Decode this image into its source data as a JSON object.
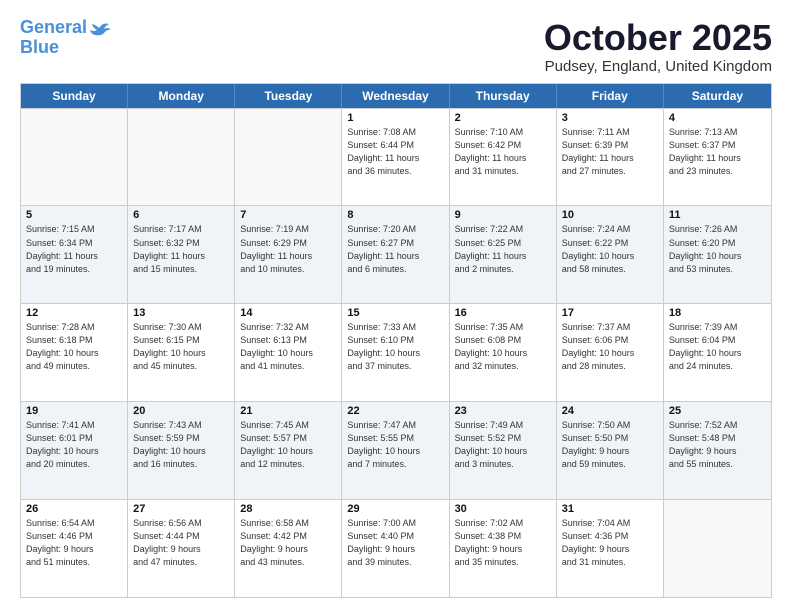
{
  "header": {
    "logo_line1": "General",
    "logo_line2": "Blue",
    "month": "October 2025",
    "location": "Pudsey, England, United Kingdom"
  },
  "weekdays": [
    "Sunday",
    "Monday",
    "Tuesday",
    "Wednesday",
    "Thursday",
    "Friday",
    "Saturday"
  ],
  "weeks": [
    [
      {
        "day": "",
        "info": "",
        "empty": true
      },
      {
        "day": "",
        "info": "",
        "empty": true
      },
      {
        "day": "",
        "info": "",
        "empty": true
      },
      {
        "day": "1",
        "info": "Sunrise: 7:08 AM\nSunset: 6:44 PM\nDaylight: 11 hours\nand 36 minutes.",
        "empty": false
      },
      {
        "day": "2",
        "info": "Sunrise: 7:10 AM\nSunset: 6:42 PM\nDaylight: 11 hours\nand 31 minutes.",
        "empty": false
      },
      {
        "day": "3",
        "info": "Sunrise: 7:11 AM\nSunset: 6:39 PM\nDaylight: 11 hours\nand 27 minutes.",
        "empty": false
      },
      {
        "day": "4",
        "info": "Sunrise: 7:13 AM\nSunset: 6:37 PM\nDaylight: 11 hours\nand 23 minutes.",
        "empty": false
      }
    ],
    [
      {
        "day": "5",
        "info": "Sunrise: 7:15 AM\nSunset: 6:34 PM\nDaylight: 11 hours\nand 19 minutes.",
        "empty": false
      },
      {
        "day": "6",
        "info": "Sunrise: 7:17 AM\nSunset: 6:32 PM\nDaylight: 11 hours\nand 15 minutes.",
        "empty": false
      },
      {
        "day": "7",
        "info": "Sunrise: 7:19 AM\nSunset: 6:29 PM\nDaylight: 11 hours\nand 10 minutes.",
        "empty": false
      },
      {
        "day": "8",
        "info": "Sunrise: 7:20 AM\nSunset: 6:27 PM\nDaylight: 11 hours\nand 6 minutes.",
        "empty": false
      },
      {
        "day": "9",
        "info": "Sunrise: 7:22 AM\nSunset: 6:25 PM\nDaylight: 11 hours\nand 2 minutes.",
        "empty": false
      },
      {
        "day": "10",
        "info": "Sunrise: 7:24 AM\nSunset: 6:22 PM\nDaylight: 10 hours\nand 58 minutes.",
        "empty": false
      },
      {
        "day": "11",
        "info": "Sunrise: 7:26 AM\nSunset: 6:20 PM\nDaylight: 10 hours\nand 53 minutes.",
        "empty": false
      }
    ],
    [
      {
        "day": "12",
        "info": "Sunrise: 7:28 AM\nSunset: 6:18 PM\nDaylight: 10 hours\nand 49 minutes.",
        "empty": false
      },
      {
        "day": "13",
        "info": "Sunrise: 7:30 AM\nSunset: 6:15 PM\nDaylight: 10 hours\nand 45 minutes.",
        "empty": false
      },
      {
        "day": "14",
        "info": "Sunrise: 7:32 AM\nSunset: 6:13 PM\nDaylight: 10 hours\nand 41 minutes.",
        "empty": false
      },
      {
        "day": "15",
        "info": "Sunrise: 7:33 AM\nSunset: 6:10 PM\nDaylight: 10 hours\nand 37 minutes.",
        "empty": false
      },
      {
        "day": "16",
        "info": "Sunrise: 7:35 AM\nSunset: 6:08 PM\nDaylight: 10 hours\nand 32 minutes.",
        "empty": false
      },
      {
        "day": "17",
        "info": "Sunrise: 7:37 AM\nSunset: 6:06 PM\nDaylight: 10 hours\nand 28 minutes.",
        "empty": false
      },
      {
        "day": "18",
        "info": "Sunrise: 7:39 AM\nSunset: 6:04 PM\nDaylight: 10 hours\nand 24 minutes.",
        "empty": false
      }
    ],
    [
      {
        "day": "19",
        "info": "Sunrise: 7:41 AM\nSunset: 6:01 PM\nDaylight: 10 hours\nand 20 minutes.",
        "empty": false
      },
      {
        "day": "20",
        "info": "Sunrise: 7:43 AM\nSunset: 5:59 PM\nDaylight: 10 hours\nand 16 minutes.",
        "empty": false
      },
      {
        "day": "21",
        "info": "Sunrise: 7:45 AM\nSunset: 5:57 PM\nDaylight: 10 hours\nand 12 minutes.",
        "empty": false
      },
      {
        "day": "22",
        "info": "Sunrise: 7:47 AM\nSunset: 5:55 PM\nDaylight: 10 hours\nand 7 minutes.",
        "empty": false
      },
      {
        "day": "23",
        "info": "Sunrise: 7:49 AM\nSunset: 5:52 PM\nDaylight: 10 hours\nand 3 minutes.",
        "empty": false
      },
      {
        "day": "24",
        "info": "Sunrise: 7:50 AM\nSunset: 5:50 PM\nDaylight: 9 hours\nand 59 minutes.",
        "empty": false
      },
      {
        "day": "25",
        "info": "Sunrise: 7:52 AM\nSunset: 5:48 PM\nDaylight: 9 hours\nand 55 minutes.",
        "empty": false
      }
    ],
    [
      {
        "day": "26",
        "info": "Sunrise: 6:54 AM\nSunset: 4:46 PM\nDaylight: 9 hours\nand 51 minutes.",
        "empty": false
      },
      {
        "day": "27",
        "info": "Sunrise: 6:56 AM\nSunset: 4:44 PM\nDaylight: 9 hours\nand 47 minutes.",
        "empty": false
      },
      {
        "day": "28",
        "info": "Sunrise: 6:58 AM\nSunset: 4:42 PM\nDaylight: 9 hours\nand 43 minutes.",
        "empty": false
      },
      {
        "day": "29",
        "info": "Sunrise: 7:00 AM\nSunset: 4:40 PM\nDaylight: 9 hours\nand 39 minutes.",
        "empty": false
      },
      {
        "day": "30",
        "info": "Sunrise: 7:02 AM\nSunset: 4:38 PM\nDaylight: 9 hours\nand 35 minutes.",
        "empty": false
      },
      {
        "day": "31",
        "info": "Sunrise: 7:04 AM\nSunset: 4:36 PM\nDaylight: 9 hours\nand 31 minutes.",
        "empty": false
      },
      {
        "day": "",
        "info": "",
        "empty": true
      }
    ]
  ]
}
